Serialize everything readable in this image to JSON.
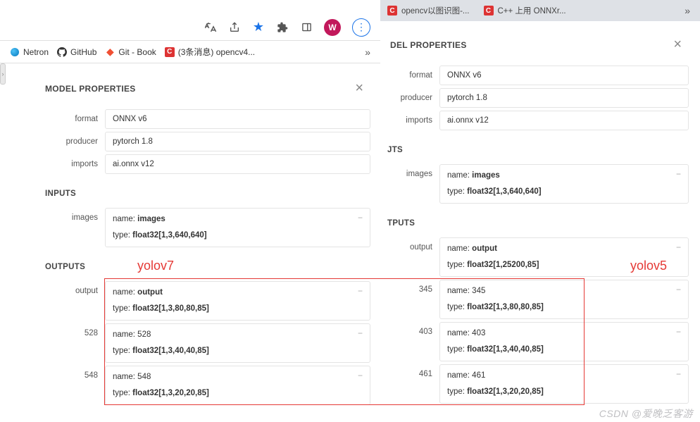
{
  "top_tabs": [
    {
      "label": "opencv以图识图-..."
    },
    {
      "label": "C++ 上用 ONNXr..."
    }
  ],
  "bookmarks": [
    {
      "label": "Netron"
    },
    {
      "label": "GitHub"
    },
    {
      "label": "Git - Book"
    },
    {
      "label": "(3条消息) opencv4..."
    }
  ],
  "left_panel": {
    "title": "MODEL PROPERTIES",
    "props": {
      "format": {
        "label": "format",
        "value": "ONNX v6"
      },
      "producer": {
        "label": "producer",
        "value": "pytorch 1.8"
      },
      "imports": {
        "label": "imports",
        "value": "ai.onnx v12"
      }
    },
    "inputs_h": "INPUTS",
    "inputs": {
      "images": {
        "label": "images",
        "name_lbl": "name:",
        "name": "images",
        "type_lbl": "type:",
        "type": "float32[1,3,640,640]"
      }
    },
    "outputs_h": "OUTPUTS",
    "outputs": [
      {
        "label": "output",
        "name_lbl": "name:",
        "name": "output",
        "type_lbl": "type:",
        "type": "float32[1,3,80,80,85]"
      },
      {
        "label": "528",
        "name_lbl": "name:",
        "name": "528",
        "type_lbl": "type:",
        "type": "float32[1,3,40,40,85]"
      },
      {
        "label": "548",
        "name_lbl": "name:",
        "name": "548",
        "type_lbl": "type:",
        "type": "float32[1,3,20,20,85]"
      }
    ]
  },
  "right_panel": {
    "title": "DEL PROPERTIES",
    "props": {
      "format": {
        "label": "format",
        "value": "ONNX v6"
      },
      "producer": {
        "label": "producer",
        "value": "pytorch 1.8"
      },
      "imports": {
        "label": "imports",
        "value": "ai.onnx v12"
      }
    },
    "inputs_h": "JTS",
    "inputs": {
      "images": {
        "label": "images",
        "name_lbl": "name:",
        "name": "images",
        "type_lbl": "type:",
        "type": "float32[1,3,640,640]"
      }
    },
    "outputs_h": "TPUTS",
    "outputs": [
      {
        "label": "output",
        "name_lbl": "name:",
        "name": "output",
        "type_lbl": "type:",
        "type": "float32[1,25200,85]"
      },
      {
        "label": "345",
        "name_lbl": "name:",
        "name": "345",
        "type_lbl": "type:",
        "type": "float32[1,3,80,80,85]"
      },
      {
        "label": "403",
        "name_lbl": "name:",
        "name": "403",
        "type_lbl": "type:",
        "type": "float32[1,3,40,40,85]"
      },
      {
        "label": "461",
        "name_lbl": "name:",
        "name": "461",
        "type_lbl": "type:",
        "type": "float32[1,3,20,20,85]"
      }
    ]
  },
  "annotations": {
    "yolov7": "yolov7",
    "yolov5": "yolov5"
  },
  "watermark": "CSDN @爱晚乏客游"
}
